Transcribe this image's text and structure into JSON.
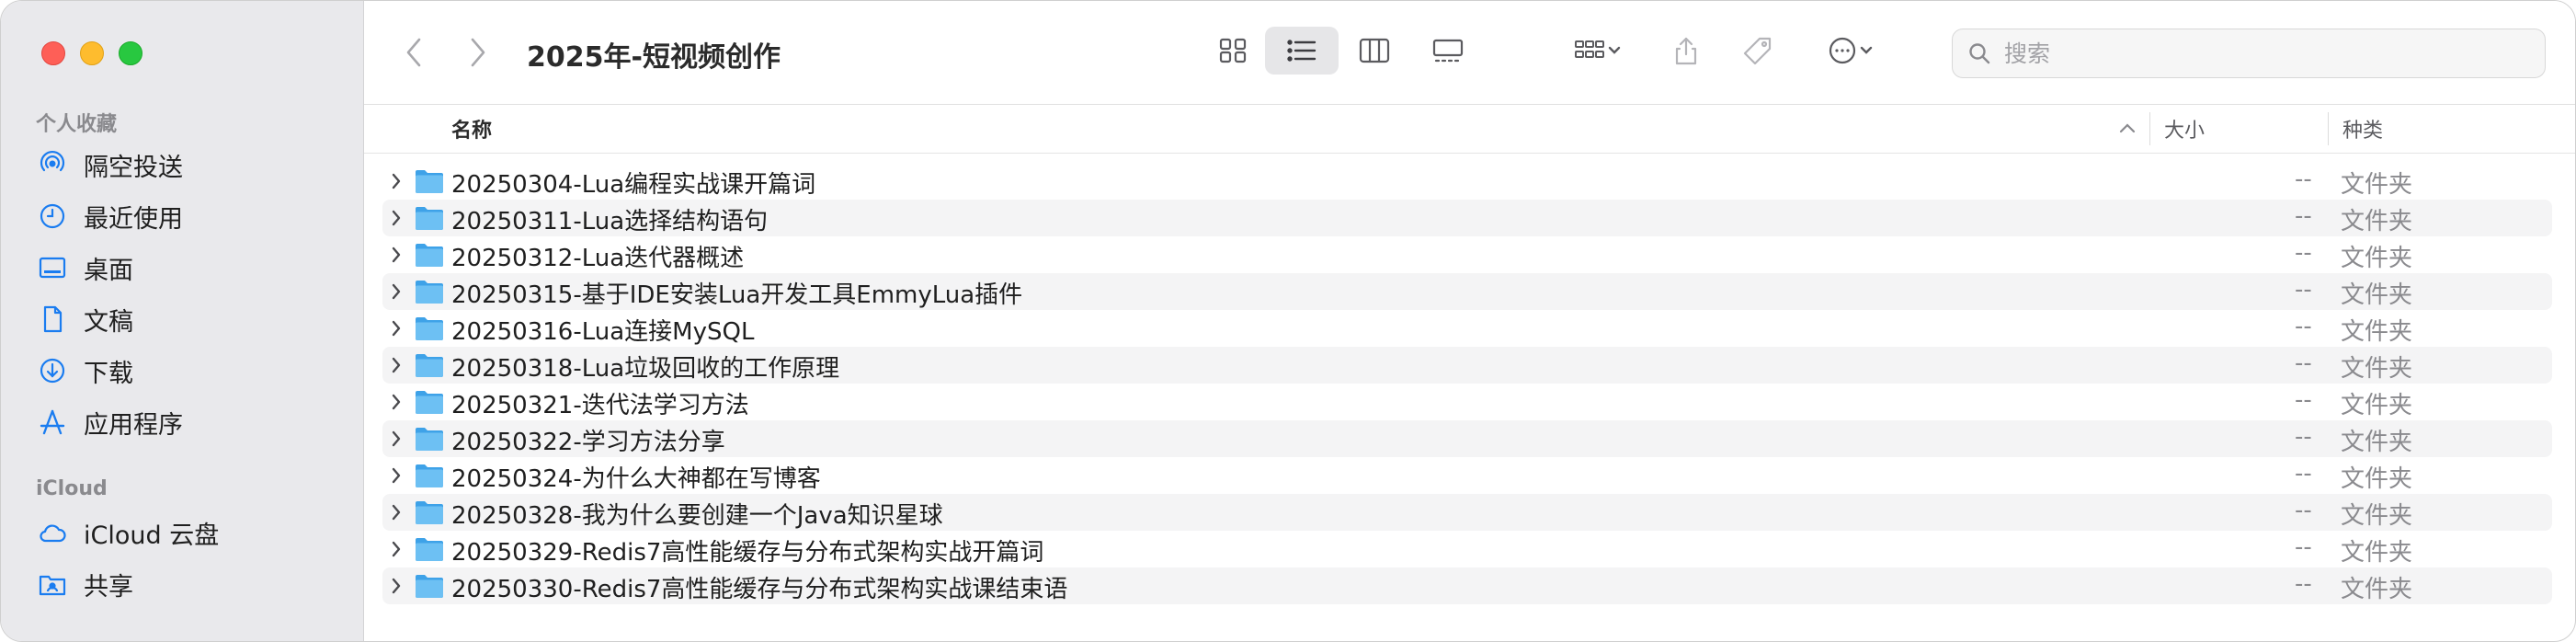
{
  "window": {
    "title": "2025年-短视频创作"
  },
  "sidebar": {
    "favorites_label": "个人收藏",
    "favorites": [
      {
        "label": "隔空投送",
        "icon": "airdrop-icon"
      },
      {
        "label": "最近使用",
        "icon": "clock-icon"
      },
      {
        "label": "桌面",
        "icon": "desktop-icon"
      },
      {
        "label": "文稿",
        "icon": "document-icon"
      },
      {
        "label": "下载",
        "icon": "download-icon"
      },
      {
        "label": "应用程序",
        "icon": "applications-icon"
      }
    ],
    "icloud_label": "iCloud",
    "icloud": [
      {
        "label": "iCloud 云盘",
        "icon": "cloud-icon"
      },
      {
        "label": "共享",
        "icon": "shared-folder-icon"
      }
    ]
  },
  "toolbar": {
    "search_placeholder": "搜索"
  },
  "columns": {
    "name": "名称",
    "size": "大小",
    "kind": "种类"
  },
  "files": [
    {
      "name": "20250304-Lua编程实战课开篇词",
      "size": "--",
      "kind": "文件夹"
    },
    {
      "name": "20250311-Lua选择结构语句",
      "size": "--",
      "kind": "文件夹"
    },
    {
      "name": "20250312-Lua迭代器概述",
      "size": "--",
      "kind": "文件夹"
    },
    {
      "name": "20250315-基于IDE安装Lua开发工具EmmyLua插件",
      "size": "--",
      "kind": "文件夹"
    },
    {
      "name": "20250316-Lua连接MySQL",
      "size": "--",
      "kind": "文件夹"
    },
    {
      "name": "20250318-Lua垃圾回收的工作原理",
      "size": "--",
      "kind": "文件夹"
    },
    {
      "name": "20250321-迭代法学习方法",
      "size": "--",
      "kind": "文件夹"
    },
    {
      "name": "20250322-学习方法分享",
      "size": "--",
      "kind": "文件夹"
    },
    {
      "name": "20250324-为什么大神都在写博客",
      "size": "--",
      "kind": "文件夹"
    },
    {
      "name": "20250328-我为什么要创建一个Java知识星球",
      "size": "--",
      "kind": "文件夹"
    },
    {
      "name": "20250329-Redis7高性能缓存与分布式架构实战开篇词",
      "size": "--",
      "kind": "文件夹"
    },
    {
      "name": "20250330-Redis7高性能缓存与分布式架构实战课结束语",
      "size": "--",
      "kind": "文件夹"
    }
  ],
  "colors": {
    "accent": "#1a7cf0",
    "folder": "#5cb3ef",
    "sidebar_bg": "#e9e9ec"
  }
}
